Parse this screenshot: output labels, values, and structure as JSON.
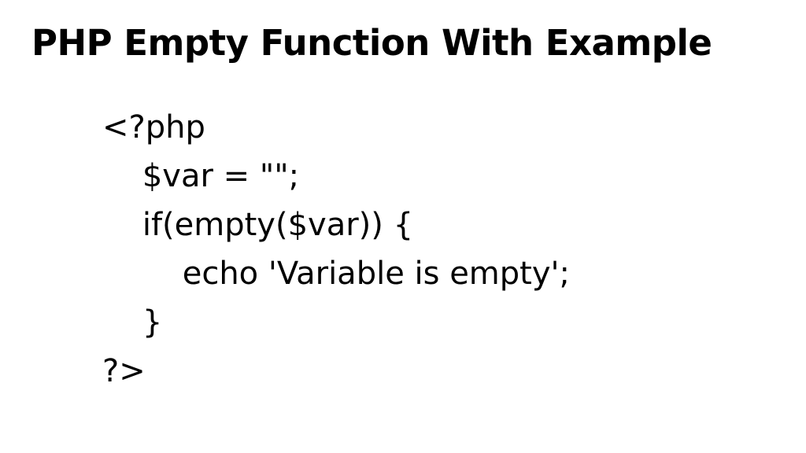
{
  "title": "PHP Empty Function With Example",
  "code": {
    "line1": "<?php",
    "line2": "    $var = \"\";",
    "line3": "    if(empty($var)) {",
    "line4": "        echo 'Variable is empty';",
    "line5": "    }",
    "line6": "?>"
  }
}
